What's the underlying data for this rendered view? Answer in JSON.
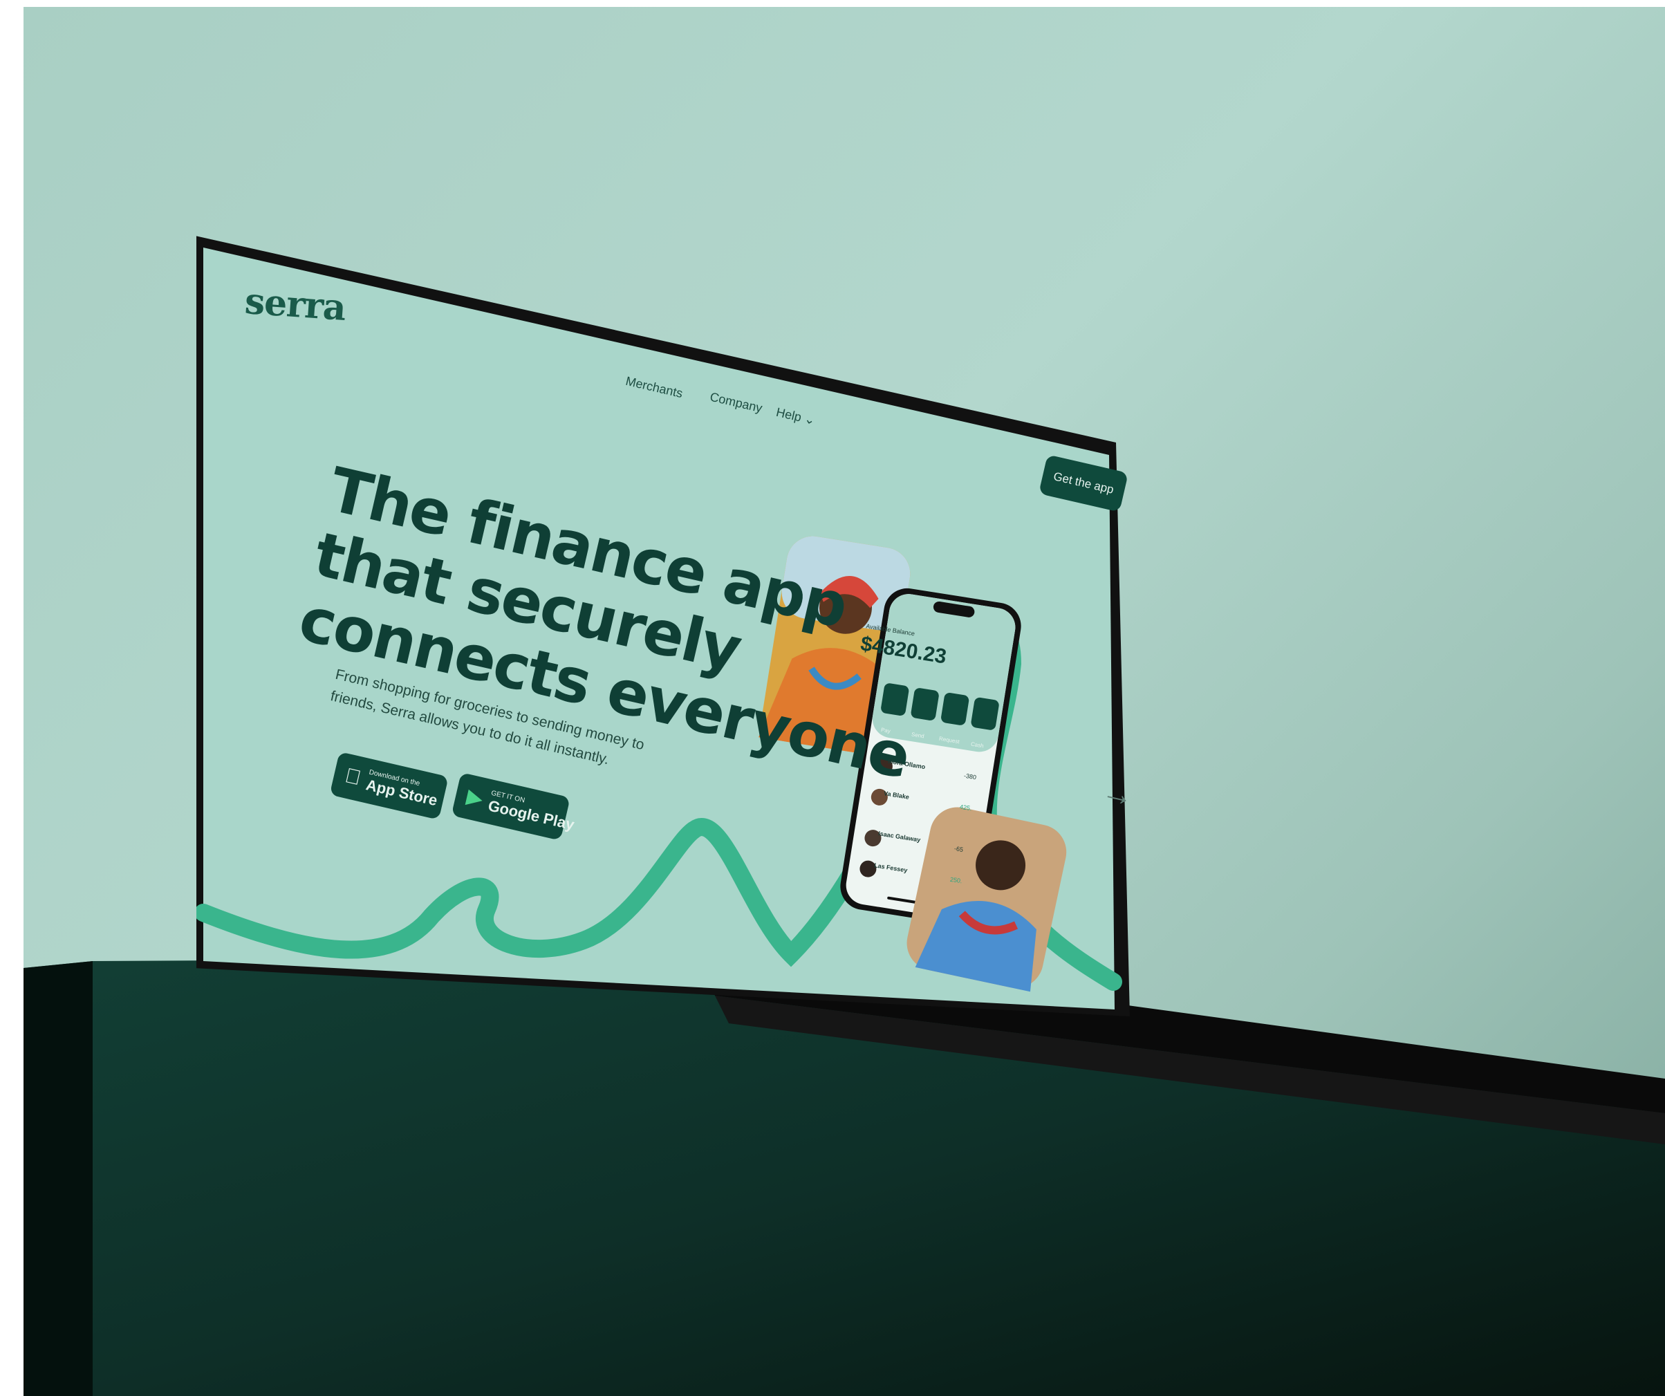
{
  "brand": {
    "logo": "serra"
  },
  "nav": {
    "items": [
      "Merchants",
      "Company",
      "Help"
    ],
    "cta": "Get the app"
  },
  "hero": {
    "title_lines": [
      "The finance app",
      "that securely",
      "connects everyone"
    ],
    "subtitle_lines": [
      "From shopping for groceries to sending money to",
      "friends, Serra allows you to do it all instantly."
    ]
  },
  "stores": {
    "apple": {
      "small": "Download on the",
      "big": "App Store"
    },
    "google": {
      "small": "GET IT ON",
      "big": "Google Play"
    }
  },
  "phone": {
    "balance_label": "Available Balance",
    "balance_amount": "$4820.23",
    "actions": [
      "Pay",
      "Send",
      "Request",
      "Cash"
    ],
    "transactions": [
      {
        "name": "Mora Ollamo",
        "amount": "-380"
      },
      {
        "name": "Va Blake",
        "amount": "425.",
        "positive": true
      },
      {
        "name": "Isaac Galaway",
        "amount": "-65"
      },
      {
        "name": "Las Fessey",
        "amount": "250.",
        "positive": true
      }
    ]
  },
  "colors": {
    "brand_dark": "#0f4a3c",
    "accent": "#3ab58d",
    "screen_bg": "#a9d6ca",
    "pedestal": "#0e2c26"
  }
}
